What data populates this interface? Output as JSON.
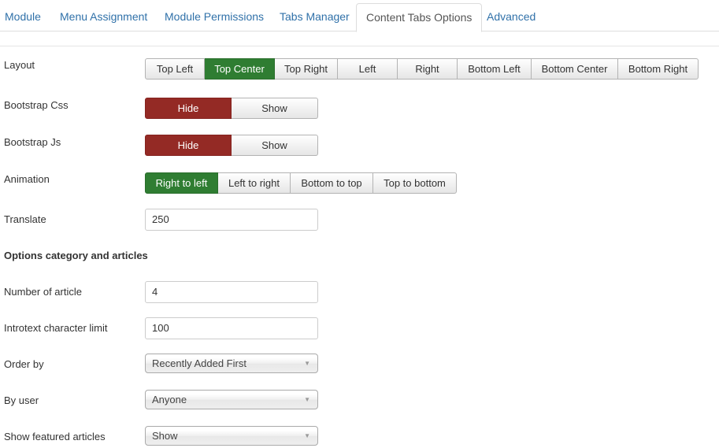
{
  "tabs": [
    {
      "label": "Module",
      "active": false
    },
    {
      "label": "Menu Assignment",
      "active": false
    },
    {
      "label": "Module Permissions",
      "active": false
    },
    {
      "label": "Tabs Manager",
      "active": false
    },
    {
      "label": "Content Tabs Options",
      "active": true
    },
    {
      "label": "Advanced",
      "active": false
    }
  ],
  "fields": {
    "layout": {
      "label": "Layout",
      "options": [
        "Top Left",
        "Top Center",
        "Top Right",
        "Left",
        "Right",
        "Bottom Left",
        "Bottom Center",
        "Bottom Right"
      ],
      "selected": "Top Center"
    },
    "bootstrap_css": {
      "label": "Bootstrap Css",
      "options": [
        "Hide",
        "Show"
      ],
      "selected": "Hide"
    },
    "bootstrap_js": {
      "label": "Bootstrap Js",
      "options": [
        "Hide",
        "Show"
      ],
      "selected": "Hide"
    },
    "animation": {
      "label": "Animation",
      "options": [
        "Right to left",
        "Left to right",
        "Bottom to top",
        "Top to bottom"
      ],
      "selected": "Right to left"
    },
    "translate": {
      "label": "Translate",
      "value": "250"
    },
    "section_heading": "Options category and articles",
    "number_of_article": {
      "label": "Number of article",
      "value": "4"
    },
    "introtext_limit": {
      "label": "Introtext character limit",
      "value": "100"
    },
    "order_by": {
      "label": "Order by",
      "value": "Recently Added First"
    },
    "by_user": {
      "label": "By user",
      "value": "Anyone"
    },
    "show_featured": {
      "label": "Show featured articles",
      "value": "Show"
    }
  },
  "colors": {
    "selected_green": "#2f7d32",
    "selected_red": "#942a25",
    "tab_link": "#3071a9"
  }
}
